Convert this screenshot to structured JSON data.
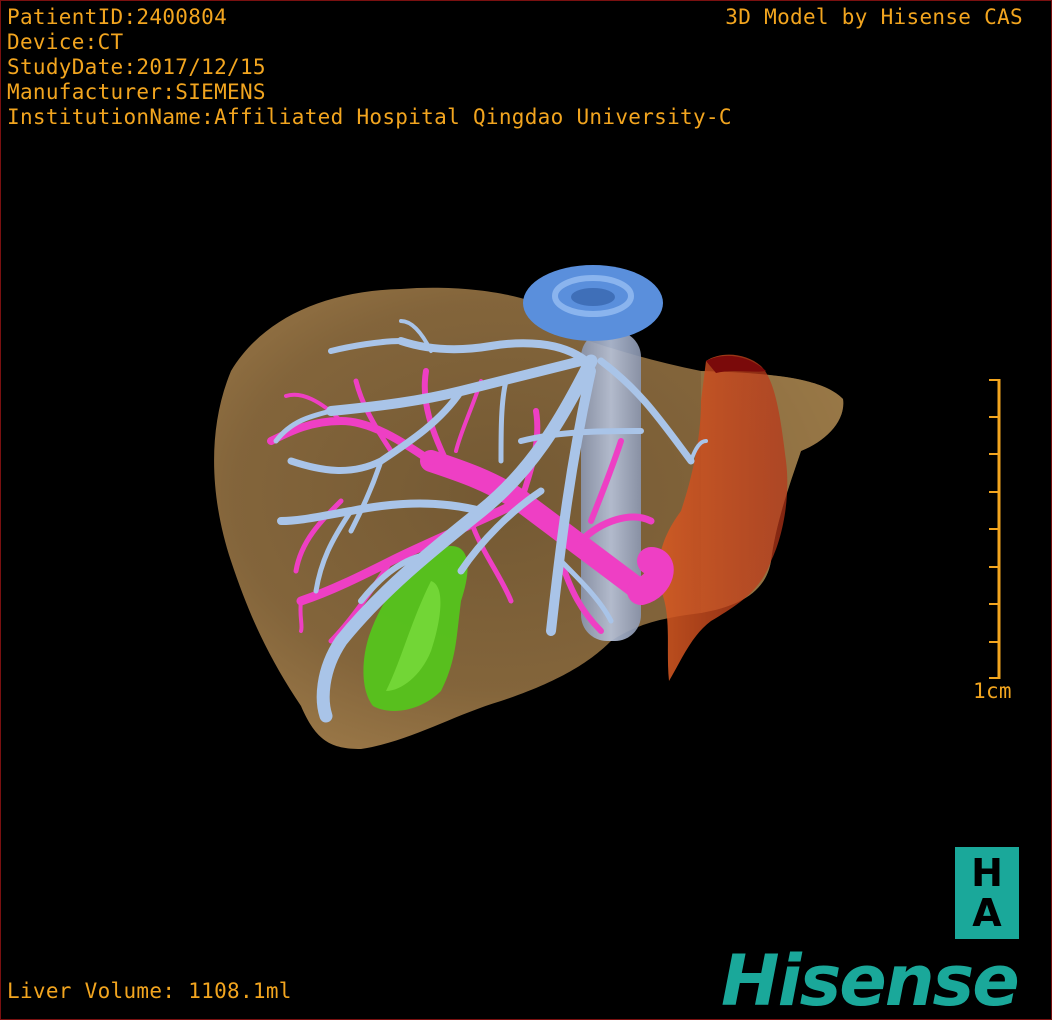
{
  "overlay": {
    "patient_id": "PatientID:2400804",
    "device": "Device:CT",
    "study_date": "StudyDate:2017/12/15",
    "manufacturer": "Manufacturer:SIEMENS",
    "institution": "InstitutionName:Affiliated Hospital Qingdao University-C",
    "credit": "3D Model by Hisense CAS",
    "liver_volume": "Liver Volume: 1108.1ml"
  },
  "scale_bar": {
    "label": "1cm"
  },
  "logo": {
    "box_top": "H",
    "box_bottom": "A",
    "brand": "Hisense"
  },
  "colors": {
    "text": "#f2a51f",
    "liver": "#8a6a3e",
    "hepatic_vein": "#a9c4e8",
    "portal_vein": "#ee3fc4",
    "gallbladder": "#55c41c",
    "ivc": "#5a8fdc",
    "tumor": "#c83a1e",
    "brand": "#1aa89a"
  }
}
